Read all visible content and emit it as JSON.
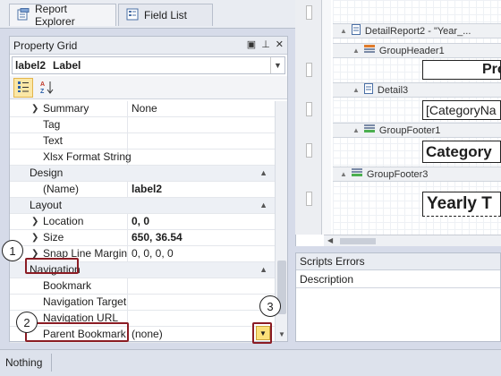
{
  "tabs": [
    {
      "label": "Report Explorer",
      "icon": "report-explorer-icon"
    },
    {
      "label": "Field List",
      "icon": "field-list-icon"
    }
  ],
  "property_grid": {
    "title": "Property Grid",
    "selected_control": "label2",
    "selected_type": "Label",
    "rows": [
      {
        "kind": "prop",
        "name": "Summary",
        "value": "None",
        "expandable": true
      },
      {
        "kind": "prop",
        "name": "Tag",
        "value": ""
      },
      {
        "kind": "prop",
        "name": "Text",
        "value": ""
      },
      {
        "kind": "prop",
        "name": "Xlsx Format String",
        "value": ""
      },
      {
        "kind": "cat",
        "name": "Design"
      },
      {
        "kind": "prop",
        "name": "(Name)",
        "value": "label2",
        "bold": true
      },
      {
        "kind": "cat",
        "name": "Layout"
      },
      {
        "kind": "prop",
        "name": "Location",
        "value": "0, 0",
        "bold": true,
        "expandable": true
      },
      {
        "kind": "prop",
        "name": "Size",
        "value": "650, 36.54",
        "bold": true,
        "expandable": true
      },
      {
        "kind": "prop",
        "name": "Snap Line Margin",
        "value": "0, 0, 0, 0",
        "expandable": true
      },
      {
        "kind": "cat",
        "name": "Navigation"
      },
      {
        "kind": "prop",
        "name": "Bookmark",
        "value": ""
      },
      {
        "kind": "prop",
        "name": "Navigation Target",
        "value": ""
      },
      {
        "kind": "prop",
        "name": "Navigation URL",
        "value": ""
      },
      {
        "kind": "prop",
        "name": "Parent Bookmark",
        "value": "(none)"
      }
    ]
  },
  "callouts": [
    "1",
    "2",
    "3"
  ],
  "designer": {
    "bands": [
      {
        "label": "DetailReport2 - \"Year_...",
        "icon": "detail-report-icon"
      },
      {
        "label": "GroupHeader1",
        "icon": "group-header-icon"
      },
      {
        "label": "Detail3",
        "icon": "detail-icon"
      },
      {
        "label": "GroupFooter1",
        "icon": "group-footer-icon"
      },
      {
        "label": "GroupFooter3",
        "icon": "group-footer-icon"
      }
    ],
    "cells": [
      "Pro",
      "[CategoryNa",
      "Category",
      "Yearly T"
    ]
  },
  "scripts_errors": {
    "title": "Scripts Errors",
    "column": "Description"
  },
  "status": {
    "text": "Nothing"
  },
  "colors": {
    "highlight": "#8b1c24",
    "accent": "#fbe07a"
  }
}
